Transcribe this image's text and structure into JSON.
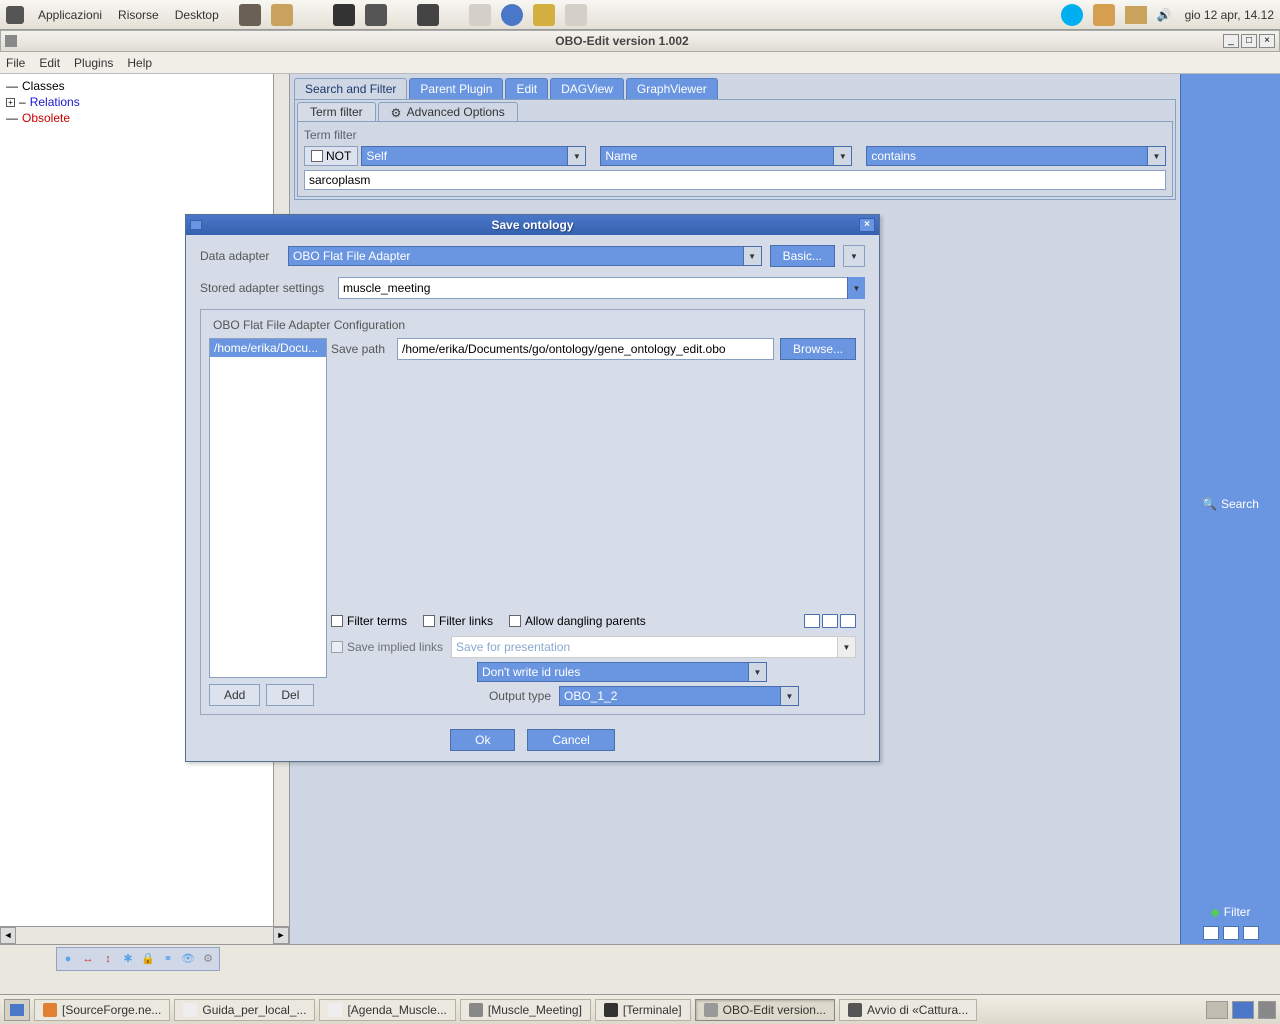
{
  "gnome": {
    "menus": [
      "Applicazioni",
      "Risorse",
      "Desktop"
    ],
    "clock": "gio 12 apr, 14.12"
  },
  "app": {
    "title": "OBO-Edit version 1.002",
    "menus": [
      "File",
      "Edit",
      "Plugins",
      "Help"
    ]
  },
  "tree": {
    "classes": "Classes",
    "relations": "Relations",
    "obsolete": "Obsolete"
  },
  "tabs": {
    "search": "Search and Filter",
    "parent": "Parent Plugin",
    "edit": "Edit",
    "dag": "DAGView",
    "graph": "GraphViewer"
  },
  "subtabs": {
    "term": "Term filter",
    "advanced": "Advanced Options"
  },
  "filter": {
    "group_label": "Term filter",
    "not": "NOT",
    "self": "Self",
    "name": "Name",
    "contains": "contains",
    "value": "sarcoplasm"
  },
  "sidebar": {
    "search": "Search",
    "filter": "Filter"
  },
  "dialog": {
    "title": "Save ontology",
    "data_adapter_label": "Data adapter",
    "data_adapter_value": "OBO Flat File Adapter",
    "basic": "Basic...",
    "stored_label": "Stored adapter settings",
    "stored_value": "muscle_meeting",
    "config_title": "OBO Flat File Adapter Configuration",
    "path_list_item": "/home/erika/Docu...",
    "save_path_label": "Save path",
    "save_path_value": "/home/erika/Documents/go/ontology/gene_ontology_edit.obo",
    "browse": "Browse...",
    "add": "Add",
    "del": "Del",
    "filter_terms": "Filter terms",
    "filter_links": "Filter links",
    "allow_dangling": "Allow dangling parents",
    "save_implied": "Save implied links",
    "save_presentation": "Save for presentation",
    "dont_write": "Don't write id rules",
    "output_type_label": "Output type",
    "output_type_value": "OBO_1_2",
    "ok": "Ok",
    "cancel": "Cancel"
  },
  "taskbar": {
    "items": [
      "[SourceForge.ne...",
      "Guida_per_local_...",
      "[Agenda_Muscle...",
      "[Muscle_Meeting]",
      "[Terminale]",
      "OBO-Edit version...",
      "Avvio di «Cattura..."
    ]
  }
}
